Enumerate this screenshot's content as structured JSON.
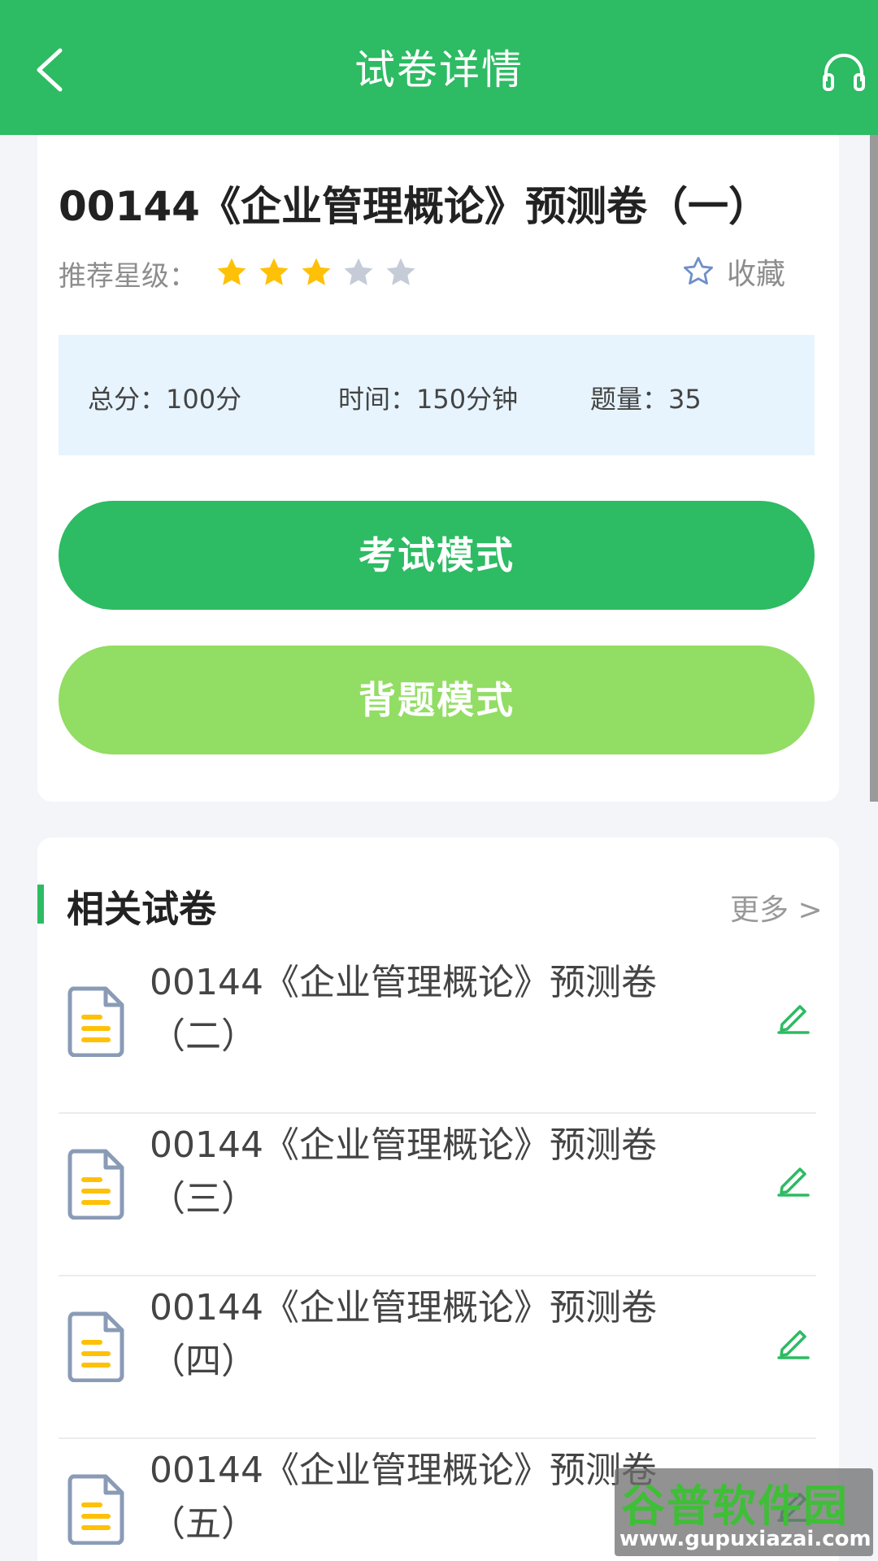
{
  "header": {
    "title": "试卷详情",
    "back_icon": "chevron-left-icon",
    "support_icon": "headset-icon"
  },
  "paper": {
    "title": "00144《企业管理概论》预测卷（一）",
    "rating_label": "推荐星级：",
    "rating": 3,
    "rating_max": 5,
    "favorite_label": "收藏",
    "info": {
      "total_score": "总分：100分",
      "time": "时间：150分钟",
      "count": "题量：35"
    },
    "exam_mode_label": "考试模式",
    "recite_mode_label": "背题模式"
  },
  "related": {
    "title": "相关试卷",
    "more_label": "更多 >",
    "items": [
      {
        "name": "00144《企业管理概论》预测卷（二）"
      },
      {
        "name": "00144《企业管理概论》预测卷（三）"
      },
      {
        "name": "00144《企业管理概论》预测卷（四）"
      },
      {
        "name": "00144《企业管理概论》预测卷（五）"
      }
    ]
  },
  "watermark": {
    "title": "谷普软件园",
    "url": "www.gupuxiazai.com"
  },
  "colors": {
    "primary": "#2dbb63",
    "secondary": "#92dd64",
    "star_on": "#ffc107",
    "star_off": "#c5ccd8",
    "info_bg": "#e7f4fe"
  }
}
